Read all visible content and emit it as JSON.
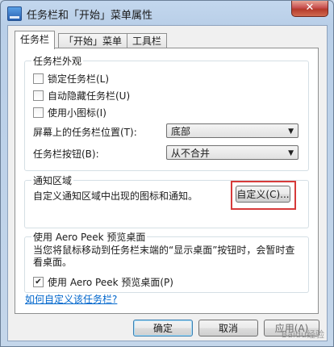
{
  "window": {
    "title": "任务栏和「开始」菜单属性",
    "close_label": "✕"
  },
  "tabs": [
    {
      "label": "任务栏",
      "active": true
    },
    {
      "label": "「开始」菜单",
      "active": false
    },
    {
      "label": "工具栏",
      "active": false
    }
  ],
  "appearance": {
    "title": "任务栏外观",
    "lock": {
      "label": "锁定任务栏(L)",
      "checked": false
    },
    "autohide": {
      "label": "自动隐藏任务栏(U)",
      "checked": false
    },
    "small_icons": {
      "label": "使用小图标(I)",
      "checked": false
    },
    "position": {
      "label": "屏幕上的任务栏位置(T):",
      "value": "底部"
    },
    "buttons": {
      "label": "任务栏按钮(B):",
      "value": "从不合并"
    }
  },
  "notification": {
    "title": "通知区域",
    "text": "自定义通知区域中出现的图标和通知。",
    "customize_label": "自定义(C)..."
  },
  "aero_peek": {
    "title": "使用 Aero Peek 预览桌面",
    "description": "当您将鼠标移动到任务栏末端的“显示桌面”按钮时，会暂时查看桌面。",
    "checkbox": {
      "label": "使用 Aero Peek 预览桌面(P)",
      "checked": true
    }
  },
  "help_link": "如何自定义该任务栏?",
  "footer": {
    "ok": "确定",
    "cancel": "取消",
    "apply": "应用(A)"
  },
  "watermark": "Baidu经验"
}
